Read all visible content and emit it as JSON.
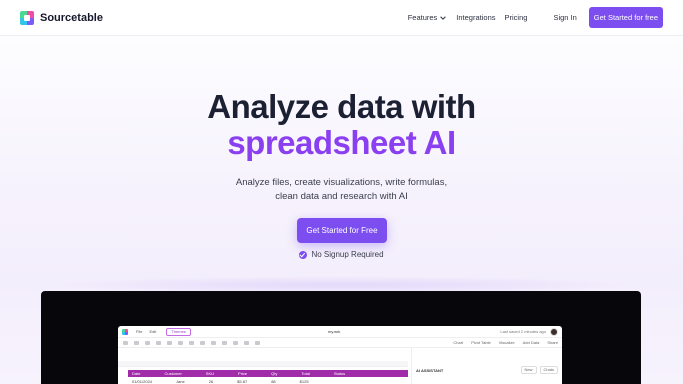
{
  "nav": {
    "brand": "Sourcetable",
    "links": [
      {
        "label": "Features",
        "has_dropdown": true
      },
      {
        "label": "Integrations",
        "has_dropdown": false
      },
      {
        "label": "Pricing",
        "has_dropdown": false
      }
    ],
    "sign_in": "Sign In",
    "cta": "Get Started for free"
  },
  "hero": {
    "title_line1": "Analyze data with",
    "title_line2": "spreadsheet AI",
    "subtitle_line1": "Analyze files, create visualizations, write formulas,",
    "subtitle_line2": "clean data and research with AI",
    "cta": "Get Started for Free",
    "note": "No Signup Required"
  },
  "app_preview": {
    "menu": [
      "File",
      "Edit"
    ],
    "theme_button": "Themes",
    "doc_title": "my.wrk",
    "share_text": "Last saved 2 minutes ago",
    "toolbar_right": [
      "Chart",
      "Pivot Table",
      "Visualize",
      "Add Data",
      "Share"
    ],
    "highlight_row": [
      "Date",
      "Customer",
      "SKU",
      "Price",
      "Qty",
      "Total",
      "Status"
    ],
    "data_row": [
      "01/01/2024",
      "Jane",
      "26",
      "$5.87",
      "88",
      "$125"
    ],
    "ai_panel_title": "AI ASSISTANT",
    "ai_buttons": [
      "New",
      "Chats"
    ]
  },
  "colors": {
    "accent": "#7c4ef0",
    "title_dark": "#1c2033",
    "title_purple": "#8a3ff0",
    "showcase_bg": "#07060b"
  }
}
